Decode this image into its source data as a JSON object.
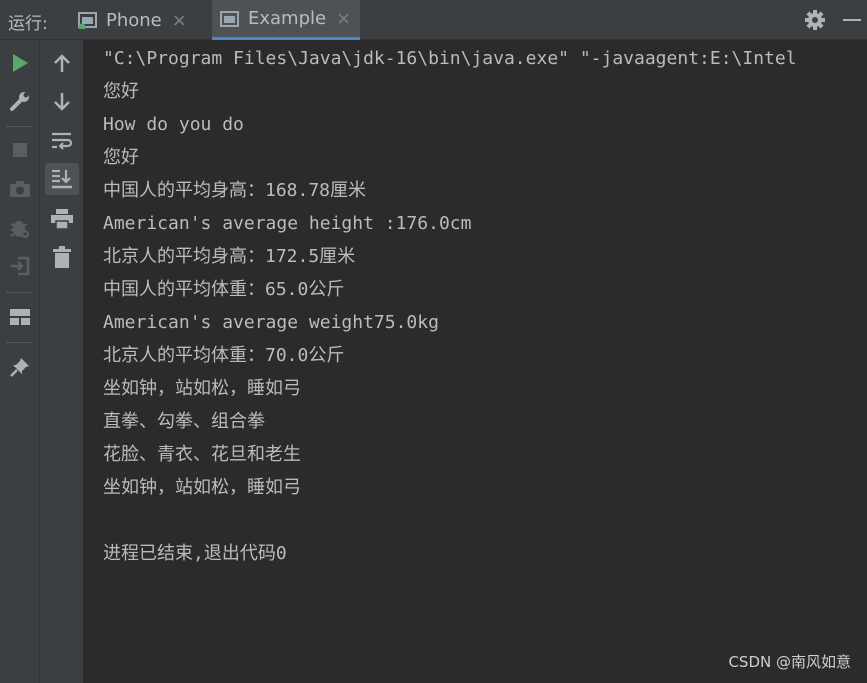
{
  "toolwindow": {
    "run_label": "运行:"
  },
  "tabs": [
    {
      "label": "Phone",
      "close": "×"
    },
    {
      "label": "Example",
      "close": "×"
    }
  ],
  "console": {
    "lines": [
      "\"C:\\Program Files\\Java\\jdk-16\\bin\\java.exe\" \"-javaagent:E:\\Intel",
      "您好",
      "How do you do",
      "您好",
      "中国人的平均身高：168.78厘米",
      "American's average height :176.0cm",
      "北京人的平均身高：172.5厘米",
      "中国人的平均体重：65.0公斤",
      "American's average weight75.0kg",
      "北京人的平均体重：70.0公斤",
      "坐如钟，站如松，睡如弓",
      "直拳、勾拳、组合拳",
      "花脸、青衣、花旦和老生",
      "坐如钟，站如松，睡如弓",
      "进程已结束,退出代码0"
    ]
  },
  "watermark": "CSDN @南风如意",
  "icons": {
    "col1": [
      "run-icon",
      "wrench-icon",
      "stop-icon",
      "camera-icon",
      "bug-settings-icon",
      "login-icon",
      "layout-icon",
      "pin-icon"
    ],
    "col2": [
      "arrow-up-icon",
      "arrow-down-icon",
      "soft-wrap-icon",
      "scroll-to-end-icon",
      "print-icon",
      "trash-icon"
    ]
  },
  "colors": {
    "background": "#2b2b2b",
    "toolbar": "#3c3f41",
    "run_green": "#59a869",
    "text": "#bbbbbb"
  }
}
